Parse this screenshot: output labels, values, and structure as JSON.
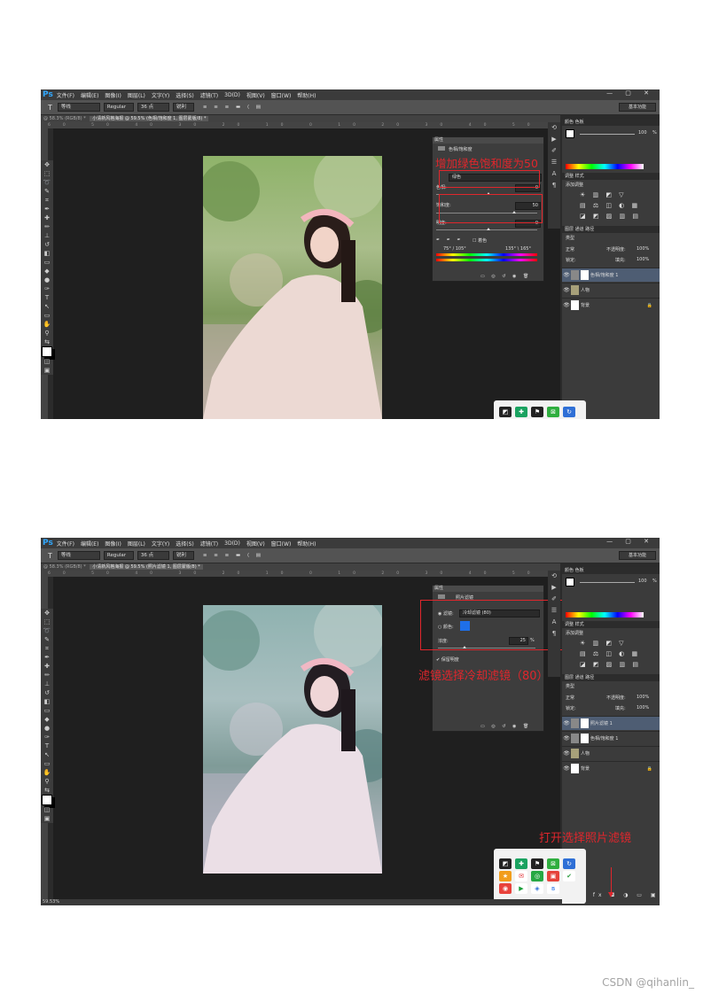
{
  "menubar": {
    "logo": "Ps",
    "items": [
      "文件(F)",
      "编辑(E)",
      "图像(I)",
      "图层(L)",
      "文字(Y)",
      "选择(S)",
      "滤镜(T)",
      "3D(D)",
      "视图(V)",
      "窗口(W)",
      "帮助(H)"
    ],
    "window_buttons": "— ▢ ✕"
  },
  "optionbar": {
    "tool": "T",
    "font_family": "等线",
    "font_style": "Regular",
    "font_size": "36 点",
    "antialias": "锐利",
    "workspace": "基本功能"
  },
  "screenshot1": {
    "tabs": [
      "@ 58.3% (RGB/8) *",
      "小清新风格海报 @ 59.5% (色相/饱和度 1, 图层蒙版/8) *"
    ],
    "ruler": "60 50 40 30 20 10 0 10 20 30 40 50 60 70 80 90 100 110 120 130 140",
    "properties": {
      "panel_title": "属性",
      "adjustment": "色相/饱和度",
      "preset": "默认值",
      "channel": "绿色",
      "hue_label": "色相:",
      "hue_value": "0",
      "saturation_label": "饱和度:",
      "saturation_value": "50",
      "saturation_fraction": 0.75,
      "lightness_label": "明度:",
      "lightness_value": "0",
      "colorize_label": "着色",
      "range_left": "75° / 105°",
      "range_right": "135° \\ 165°"
    },
    "annotation": "增加绿色饱和度为50"
  },
  "screenshot2": {
    "tabs": [
      "@ 58.3% (RGB/8) *",
      "小清新风格海报 @ 59.5% (照片滤镜 1, 图层蒙版/8) *"
    ],
    "ruler": "60 50 40 30 20 10 0 10 20 30 40 50 60 70 80 90 100 110 120 130 140",
    "properties": {
      "panel_title": "属性",
      "adjustment": "照片滤镜",
      "filter_label": "滤镜:",
      "filter_value": "冷却滤镜 (80)",
      "color_label": "颜色:",
      "density_label": "浓度:",
      "density_value": "25",
      "density_unit": "%",
      "preserve_label": "保留明度"
    },
    "annotation_filter": "滤镜选择冷却滤镜（80）",
    "annotation_open": "打开选择照片滤镜",
    "status": "59.53%"
  },
  "right_panel": {
    "tabs_color": [
      "颜色",
      "色板"
    ],
    "opacity_value": "100",
    "opacity_unit": "%",
    "tabs_adjust": [
      "调整",
      "样式"
    ],
    "add_adjust": "添加调整",
    "tabs_layers": [
      "图层",
      "通道",
      "路径"
    ],
    "kind": "类型",
    "blend": "正常",
    "opacity_label": "不透明度:",
    "opacity": "100%",
    "lock_label": "锁定:",
    "fill_label": "填充:",
    "fill": "100%",
    "layers1": [
      "色相/饱和度 1",
      "人物",
      "背景"
    ],
    "layers2": [
      "照片滤镜 1",
      "色相/饱和度 1",
      "人物",
      "背景"
    ]
  },
  "colors": {
    "ps_blue": "#31a8ff",
    "annotation_red": "#e0262c",
    "filter_swatch": "#1f6fe8",
    "selected_layer": "#4e5d73"
  },
  "watermark": "CSDN @qihanlin_"
}
